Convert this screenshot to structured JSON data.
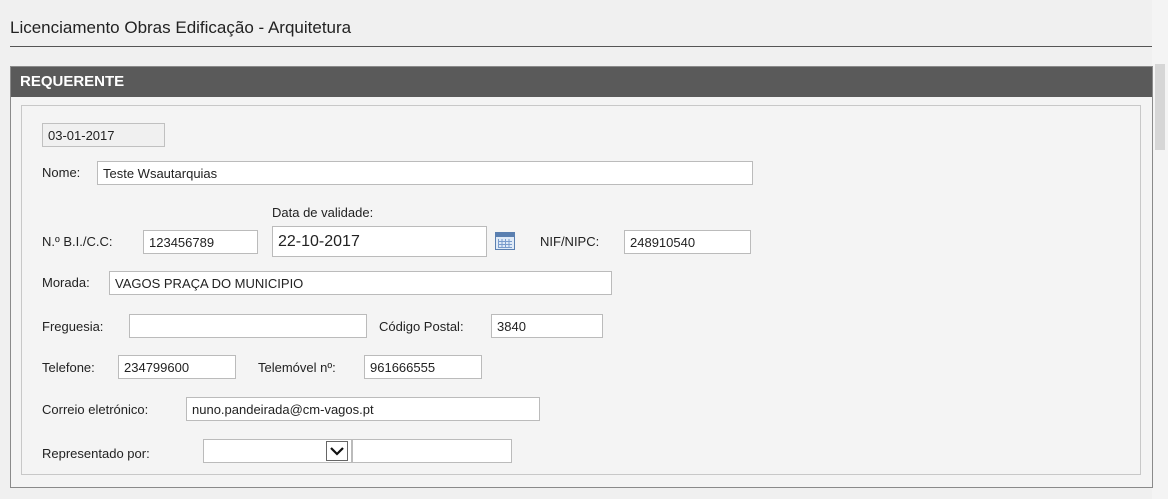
{
  "page": {
    "title": "Licenciamento Obras Edificação - Arquitetura"
  },
  "section": {
    "header": "REQUERENTE"
  },
  "form": {
    "date_value": "03-01-2017",
    "nome_label": "Nome:",
    "nome_value": "Teste Wsautarquias",
    "bi_label": "N.º B.I./C.C:",
    "bi_value": "123456789",
    "validade_label": "Data de validade:",
    "validade_value": "22-10-2017",
    "nif_label": "NIF/NIPC:",
    "nif_value": "248910540",
    "morada_label": "Morada:",
    "morada_value": "VAGOS PRAÇA DO MUNICIPIO",
    "freguesia_label": "Freguesia:",
    "freguesia_value": "",
    "codigo_postal_label": "Código Postal:",
    "codigo_postal_value": "3840",
    "telefone_label": "Telefone:",
    "telefone_value": "234799600",
    "telemovel_label": "Telemóvel nº:",
    "telemovel_value": "961666555",
    "email_label": "Correio eletrónico:",
    "email_value": "nuno.pandeirada@cm-vagos.pt",
    "representado_label": "Representado por:",
    "representado_select_value": "",
    "representado_text_value": ""
  },
  "icons": {
    "calendar": "calendar-icon",
    "dropdown": "chevron-down-icon"
  }
}
